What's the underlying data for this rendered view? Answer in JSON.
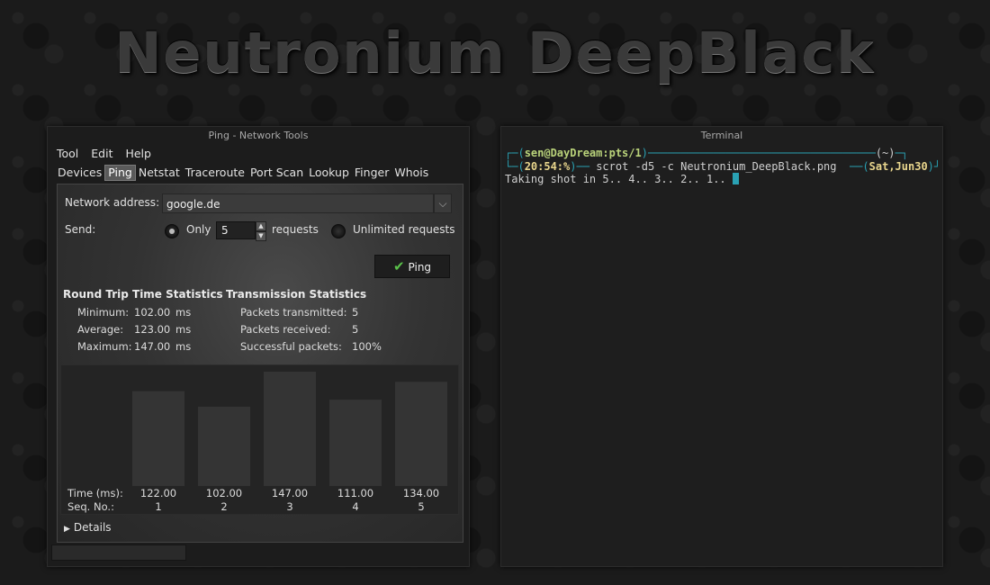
{
  "banner": {
    "title": "Neutronium DeepBlack"
  },
  "ping_window": {
    "title": "Ping - Network Tools",
    "menu": [
      "Tool",
      "Edit",
      "Help"
    ],
    "tabs": [
      "Devices",
      "Ping",
      "Netstat",
      "Traceroute",
      "Port Scan",
      "Lookup",
      "Finger",
      "Whois"
    ],
    "active_tab": "Ping",
    "network_address_label": "Network address:",
    "network_address_value": "google.de",
    "send_label": "Send:",
    "only_label": "Only",
    "requests_count": "5",
    "requests_label": "requests",
    "unlimited_label": "Unlimited requests",
    "ping_button": "Ping",
    "rtt": {
      "heading": "Round Trip Time Statistics",
      "rows": [
        {
          "label": "Minimum:",
          "value": "102.00",
          "unit": "ms"
        },
        {
          "label": "Average:",
          "value": "123.00",
          "unit": "ms"
        },
        {
          "label": "Maximum:",
          "value": "147.00",
          "unit": "ms"
        }
      ]
    },
    "tx": {
      "heading": "Transmission Statistics",
      "rows": [
        {
          "label": "Packets transmitted:",
          "value": "5"
        },
        {
          "label": "Packets received:",
          "value": "5"
        },
        {
          "label": "Successful packets:",
          "value": "100%"
        }
      ]
    },
    "details_label": "Details",
    "colors": {
      "bar": "#343434",
      "check": "#5ac24a"
    }
  },
  "chart_data": {
    "type": "bar",
    "time_label": "Time (ms):",
    "seq_label": "Seq. No.:",
    "categories": [
      "1",
      "2",
      "3",
      "4",
      "5"
    ],
    "values": [
      122.0,
      102.0,
      147.0,
      111.0,
      134.0
    ],
    "value_labels": [
      "122.00",
      "102.00",
      "147.00",
      "111.00",
      "134.00"
    ],
    "ylim": [
      0,
      147
    ]
  },
  "terminal": {
    "title": "Terminal",
    "prompt_user": "sen@DayDream:pts/1",
    "prompt_dir": "(~)",
    "prompt_time": "20:54:%",
    "command": "scrot -d5 -c Neutronium_DeepBlack.png",
    "prompt_date": "Sat,Jun30",
    "output": "Taking shot in 5.. 4.. 3.. 2.. 1..",
    "colors": {
      "accent": "#2aa1b3",
      "user": "#b9d27a",
      "date": "#e9d68d"
    }
  }
}
